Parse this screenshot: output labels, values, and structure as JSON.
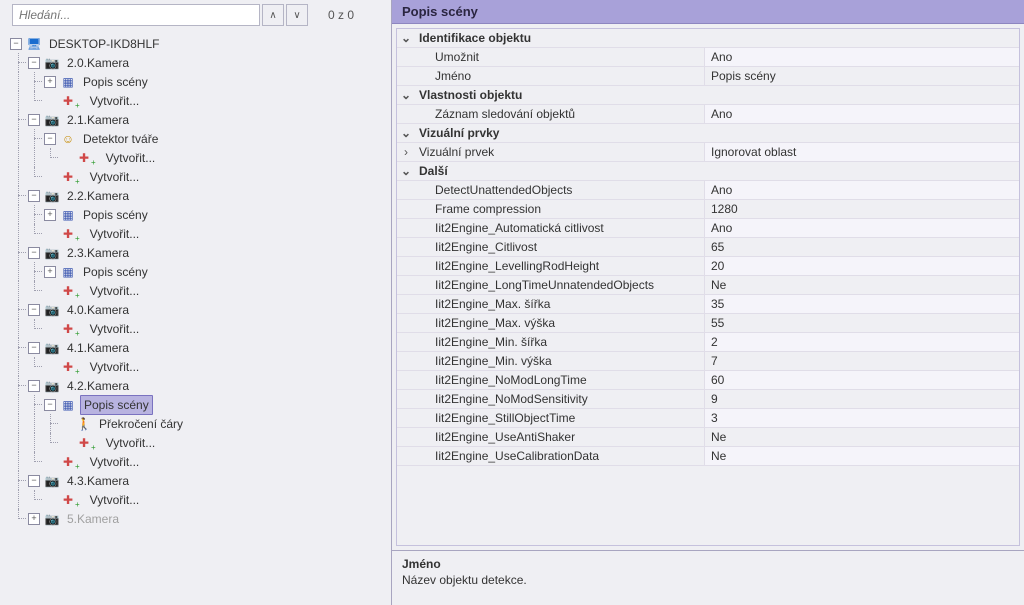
{
  "search": {
    "placeholder": "Hledání...",
    "count": "0 z 0"
  },
  "tree": {
    "root": "DESKTOP-IKD8HLF",
    "cam20": "2.0.Kamera",
    "cam21": "2.1.Kamera",
    "cam22": "2.2.Kamera",
    "cam23": "2.3.Kamera",
    "cam40": "4.0.Kamera",
    "cam41": "4.1.Kamera",
    "cam42": "4.2.Kamera",
    "cam43": "4.3.Kamera",
    "cam5": "5.Kamera",
    "scene": "Popis scény",
    "create": "Vytvořit...",
    "facedet": "Detektor tváře",
    "crossline": "Překročení čáry"
  },
  "panel": {
    "title": "Popis scény"
  },
  "cats": {
    "ident": "Identifikace objektu",
    "props": "Vlastnosti objektu",
    "visual": "Vizuální prvky",
    "other": "Další"
  },
  "pg": {
    "enable_k": "Umožnit",
    "enable_v": "Ano",
    "name_k": "Jméno",
    "name_v": "Popis scény",
    "track_k": "Záznam sledování objektů",
    "track_v": "Ano",
    "vprvek_k": "Vizuální prvek",
    "vprvek_v": "Ignorovat oblast",
    "duo_k": "DetectUnattendedObjects",
    "duo_v": "Ano",
    "fc_k": "Frame compression",
    "fc_v": "1280",
    "ac_k": "Iit2Engine_Automatická citlivost",
    "ac_v": "Ano",
    "cit_k": "Iit2Engine_Citlivost",
    "cit_v": "65",
    "lrh_k": "Iit2Engine_LevellingRodHeight",
    "lrh_v": "20",
    "ltuo_k": "Iit2Engine_LongTimeUnnatendedObjects",
    "ltuo_v": "Ne",
    "maxw_k": "Iit2Engine_Max. šířka",
    "maxw_v": "35",
    "maxh_k": "Iit2Engine_Max. výška",
    "maxh_v": "55",
    "minw_k": "Iit2Engine_Min. šířka",
    "minw_v": "2",
    "minh_k": "Iit2Engine_Min. výška",
    "minh_v": "7",
    "nmlt_k": "Iit2Engine_NoModLongTime",
    "nmlt_v": "60",
    "nms_k": "Iit2Engine_NoModSensitivity",
    "nms_v": "9",
    "sot_k": "Iit2Engine_StillObjectTime",
    "sot_v": "3",
    "uas_k": "Iit2Engine_UseAntiShaker",
    "uas_v": "Ne",
    "ucd_k": "Iit2Engine_UseCalibrationData",
    "ucd_v": "Ne"
  },
  "help": {
    "title": "Jméno",
    "text": "Název objektu detekce."
  }
}
